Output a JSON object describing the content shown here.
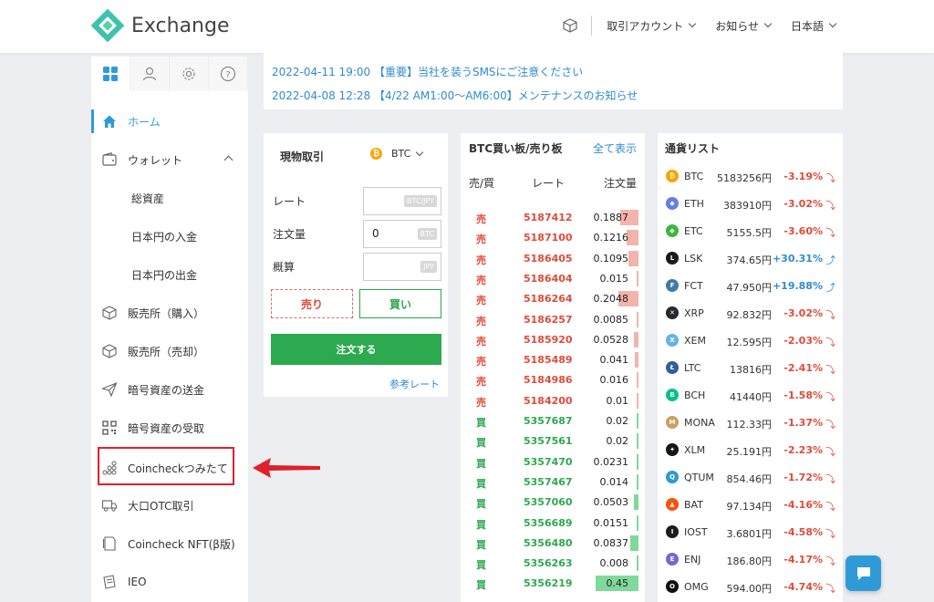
{
  "header": {
    "brand": "Exchange",
    "menus": [
      "取引アカウント",
      "お知らせ",
      "日本語"
    ]
  },
  "news": [
    "2022-04-11 19:00 【重要】当社を装うSMSにご注意ください",
    "2022-04-08 12:28 【4/22 AM1:00〜AM6:00】メンテナンスのお知らせ"
  ],
  "sidebar": {
    "items": [
      {
        "label": "ホーム",
        "icon": "home-icon",
        "active": true
      },
      {
        "label": "ウォレット",
        "icon": "wallet-icon"
      },
      {
        "label": "総資産",
        "sub": true
      },
      {
        "label": "日本円の入金",
        "sub": true
      },
      {
        "label": "日本円の出金",
        "sub": true
      },
      {
        "label": "販売所（購入）",
        "icon": "cube-icon"
      },
      {
        "label": "販売所（売却）",
        "icon": "cube-icon"
      },
      {
        "label": "暗号資産の送金",
        "icon": "send-icon"
      },
      {
        "label": "暗号資産の受取",
        "icon": "qr-icon"
      },
      {
        "label": "Coincheckつみたて",
        "icon": "coins-icon"
      },
      {
        "label": "大口OTC取引",
        "icon": "truck-icon"
      },
      {
        "label": "Coincheck NFT(β版)",
        "icon": "nft-icon"
      },
      {
        "label": "IEO",
        "icon": "ieo-icon"
      }
    ]
  },
  "trade": {
    "title": "現物取引",
    "coin": "BTC",
    "labels": [
      "レート",
      "注文量",
      "概算"
    ],
    "units": [
      "BTC/JPY",
      "BTC",
      "JPY"
    ],
    "qty_value": "0",
    "sell": "売り",
    "buy": "買い",
    "order": "注文する",
    "ref": "参考レート"
  },
  "book": {
    "title": "BTC買い板/売り板",
    "show_all": "全て表示",
    "headers": [
      "売/買",
      "レート",
      "注文量"
    ],
    "rows": [
      {
        "side": "売",
        "rate": "5187412",
        "qty": "0.1887",
        "depth": 0.11
      },
      {
        "side": "売",
        "rate": "5187100",
        "qty": "0.1216",
        "depth": 0.07
      },
      {
        "side": "売",
        "rate": "5186405",
        "qty": "0.1095",
        "depth": 0.06
      },
      {
        "side": "売",
        "rate": "5186404",
        "qty": "0.015",
        "depth": 0.01
      },
      {
        "side": "売",
        "rate": "5186264",
        "qty": "0.2048",
        "depth": 0.12
      },
      {
        "side": "売",
        "rate": "5186257",
        "qty": "0.0085",
        "depth": 0.005
      },
      {
        "side": "売",
        "rate": "5185920",
        "qty": "0.0528",
        "depth": 0.03
      },
      {
        "side": "売",
        "rate": "5185489",
        "qty": "0.041",
        "depth": 0.02
      },
      {
        "side": "売",
        "rate": "5184986",
        "qty": "0.016",
        "depth": 0.01
      },
      {
        "side": "売",
        "rate": "5184200",
        "qty": "0.01",
        "depth": 0.005
      },
      {
        "side": "買",
        "rate": "5357687",
        "qty": "0.02",
        "depth": 0.01
      },
      {
        "side": "買",
        "rate": "5357561",
        "qty": "0.02",
        "depth": 0.01
      },
      {
        "side": "買",
        "rate": "5357470",
        "qty": "0.0231",
        "depth": 0.013
      },
      {
        "side": "買",
        "rate": "5357467",
        "qty": "0.014",
        "depth": 0.008
      },
      {
        "side": "買",
        "rate": "5357060",
        "qty": "0.0503",
        "depth": 0.03
      },
      {
        "side": "買",
        "rate": "5356689",
        "qty": "0.0151",
        "depth": 0.009
      },
      {
        "side": "買",
        "rate": "5356480",
        "qty": "0.0837",
        "depth": 0.05
      },
      {
        "side": "買",
        "rate": "5356263",
        "qty": "0.008",
        "depth": 0.005
      },
      {
        "side": "買",
        "rate": "5356219",
        "qty": "0.45",
        "depth": 0.26
      }
    ]
  },
  "currency": {
    "title": "通貨リスト",
    "rows": [
      {
        "sym": "BTC",
        "price": "5183256円",
        "chg": "-3.19%",
        "dir": "down",
        "color": "#f7a600",
        "icon": "btc-icon"
      },
      {
        "sym": "ETH",
        "price": "383910円",
        "chg": "-3.02%",
        "dir": "down",
        "color": "#627eea",
        "icon": "eth-icon"
      },
      {
        "sym": "ETC",
        "price": "5155.5円",
        "chg": "-3.60%",
        "dir": "down",
        "color": "#3ab83a",
        "icon": "etc-icon"
      },
      {
        "sym": "LSK",
        "price": "374.65円",
        "chg": "+30.31%",
        "dir": "up",
        "color": "#1a1a1a",
        "icon": "lsk-icon"
      },
      {
        "sym": "FCT",
        "price": "47.950円",
        "chg": "+19.88%",
        "dir": "up",
        "color": "#417ba4",
        "icon": "fct-icon"
      },
      {
        "sym": "XRP",
        "price": "92.832円",
        "chg": "-3.02%",
        "dir": "down",
        "color": "#23292f",
        "icon": "xrp-icon"
      },
      {
        "sym": "XEM",
        "price": "12.595円",
        "chg": "-2.03%",
        "dir": "down",
        "color": "#67b2e8",
        "icon": "xem-icon"
      },
      {
        "sym": "LTC",
        "price": "13816円",
        "chg": "-2.41%",
        "dir": "down",
        "color": "#345d9d",
        "icon": "ltc-icon"
      },
      {
        "sym": "BCH",
        "price": "41440円",
        "chg": "-1.58%",
        "dir": "down",
        "color": "#0ac18e",
        "icon": "bch-icon"
      },
      {
        "sym": "MONA",
        "price": "112.33円",
        "chg": "-1.37%",
        "dir": "down",
        "color": "#c9a15e",
        "icon": "mona-icon"
      },
      {
        "sym": "XLM",
        "price": "25.191円",
        "chg": "-2.23%",
        "dir": "down",
        "color": "#14171a",
        "icon": "xlm-icon"
      },
      {
        "sym": "QTUM",
        "price": "854.46円",
        "chg": "-1.72%",
        "dir": "down",
        "color": "#2e9ad0",
        "icon": "qtum-icon"
      },
      {
        "sym": "BAT",
        "price": "97.134円",
        "chg": "-4.16%",
        "dir": "down",
        "color": "#ff5000",
        "icon": "bat-icon"
      },
      {
        "sym": "IOST",
        "price": "3.6801円",
        "chg": "-4.58%",
        "dir": "down",
        "color": "#1c1c1c",
        "icon": "iost-icon"
      },
      {
        "sym": "ENJ",
        "price": "186.80円",
        "chg": "-4.17%",
        "dir": "down",
        "color": "#7866d5",
        "icon": "enj-icon"
      },
      {
        "sym": "OMG",
        "price": "594.00円",
        "chg": "-4.74%",
        "dir": "down",
        "color": "#101010",
        "icon": "omg-icon"
      }
    ]
  }
}
